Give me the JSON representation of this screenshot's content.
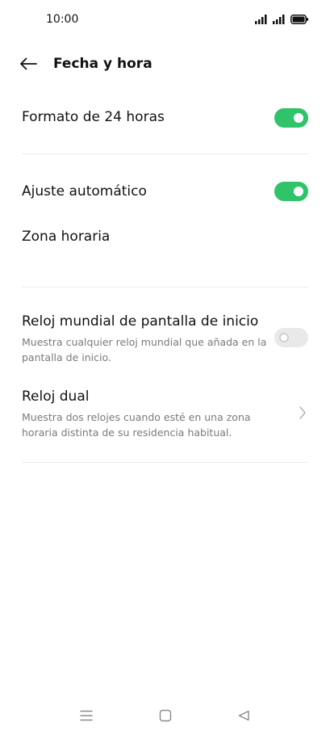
{
  "status_bar": {
    "time": "10:00",
    "icons": [
      "signal-icon",
      "signal-icon",
      "battery-icon"
    ]
  },
  "header": {
    "title": "Fecha y hora",
    "back_icon": "arrow-left-icon"
  },
  "settings": {
    "format_24h": {
      "label": "Formato de 24 horas",
      "enabled": true
    },
    "auto_adjust": {
      "label": "Ajuste automático",
      "enabled": true
    },
    "time_zone": {
      "label": "Zona horaria"
    },
    "world_clock": {
      "label": "Reloj mundial de pantalla de inicio",
      "description": "Muestra cualquier reloj mundial que añada en la pantalla de inicio.",
      "enabled": false
    },
    "dual_clock": {
      "label": "Reloj dual",
      "description": "Muestra dos relojes cuando esté en una zona horaria distinta de su residencia habitual."
    }
  },
  "colors": {
    "toggle_on": "#2fc36a",
    "toggle_off": "#e9e9e9"
  },
  "nav_bar": {
    "icons": [
      "menu-icon",
      "home-icon",
      "back-triangle-icon"
    ]
  }
}
